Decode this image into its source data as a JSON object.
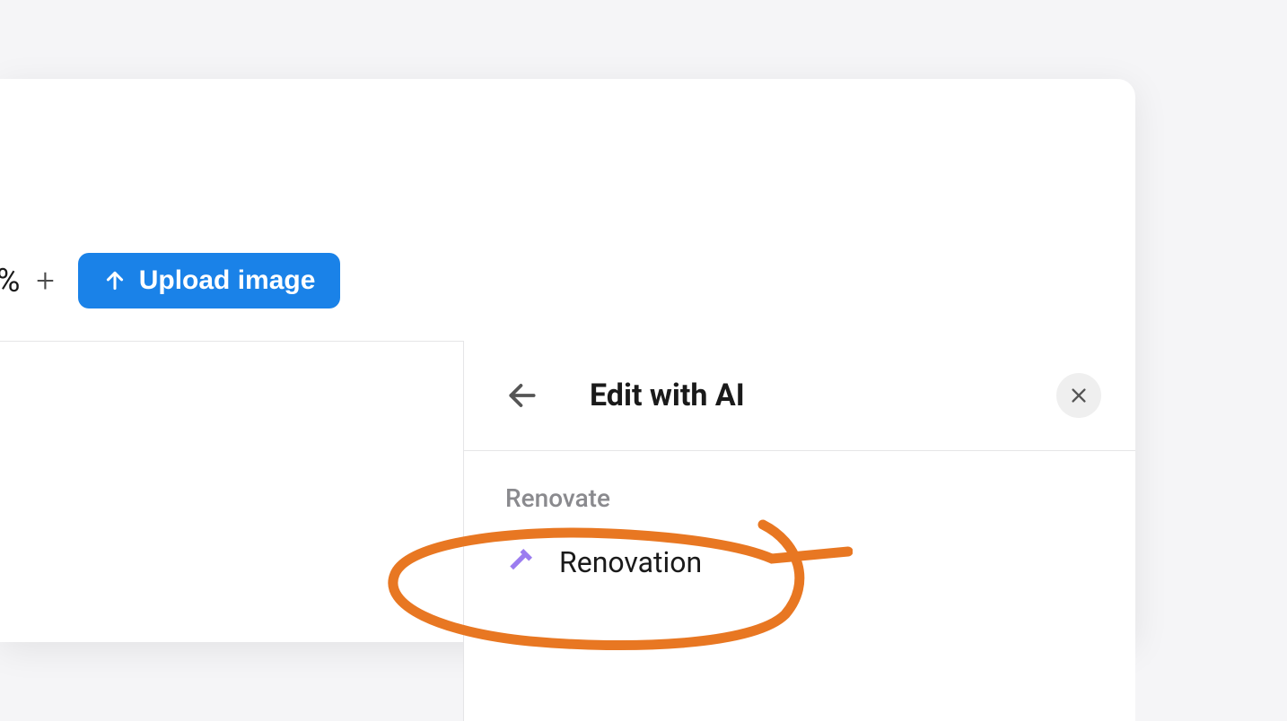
{
  "toolbar": {
    "percent_fragment": "%",
    "upload_button_label": "Upload image"
  },
  "ai_panel": {
    "title": "Edit with AI",
    "section_label": "Renovate",
    "items": [
      {
        "label": "Renovation",
        "icon": "hammer-icon"
      }
    ]
  },
  "colors": {
    "primary_button": "#1a82e8",
    "icon_purple": "#9b7cf0",
    "annotation_orange": "#e87722"
  }
}
